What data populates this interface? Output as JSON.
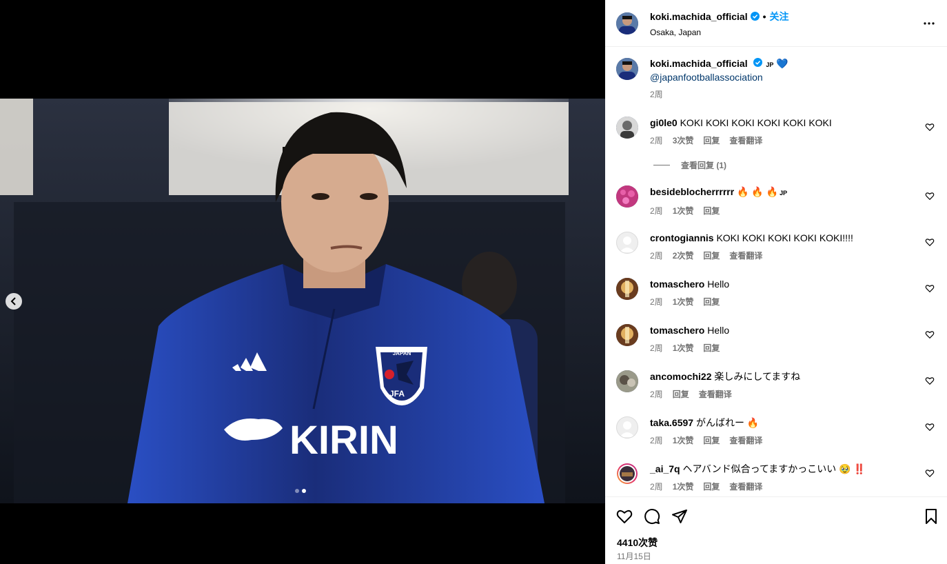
{
  "header": {
    "username": "koki.machida_official",
    "separator": "•",
    "follow_label": "关注",
    "location": "Osaka, Japan"
  },
  "caption": {
    "username": "koki.machida_official",
    "flag_text": "JP",
    "mention": "@japanfootballassociation",
    "time": "2周"
  },
  "comments": [
    {
      "username": "gi0le0",
      "text": "KOKI KOKI KOKI KOKI KOKI KOKI",
      "time": "2周",
      "likes": "3次赞",
      "reply": "回复",
      "translate": "查看翻译"
    },
    {
      "username": "besideblocherrrrrr",
      "text": "🔥 🔥 🔥",
      "flag": "JP",
      "time": "2周",
      "likes": "1次赞",
      "reply": "回复"
    },
    {
      "username": "crontogiannis",
      "text": "KOKI KOKI KOKI KOKI KOKI!!!!",
      "time": "2周",
      "likes": "2次赞",
      "reply": "回复",
      "translate": "查看翻译"
    },
    {
      "username": "tomaschero",
      "text": "Hello",
      "time": "2周",
      "likes": "1次赞",
      "reply": "回复"
    },
    {
      "username": "tomaschero",
      "text": "Hello",
      "time": "2周",
      "likes": "1次赞",
      "reply": "回复"
    },
    {
      "username": "ancomochi22",
      "text": "楽しみにしてますね",
      "time": "2周",
      "reply": "回复",
      "translate": "查看翻译"
    },
    {
      "username": "taka.6597",
      "text": "がんばれー 🔥",
      "time": "2周",
      "likes": "1次赞",
      "reply": "回复",
      "translate": "查看翻译"
    },
    {
      "username": "_ai_7q",
      "text": "ヘアバンド似合ってますかっこいい 🥹 ‼️",
      "time": "2周",
      "likes": "1次赞",
      "reply": "回复",
      "translate": "查看翻译"
    }
  ],
  "view_replies": "查看回复 (1)",
  "footer": {
    "likes": "4410次赞",
    "date": "11月15日"
  },
  "media": {
    "jersey_text": "KIRIN",
    "crest_top": "JAPAN",
    "crest_bottom": "JFA",
    "slide_count": 2,
    "active_slide": 2
  },
  "colors": {
    "link_blue": "#0095f6",
    "mention_blue": "#00376b",
    "secondary_text": "#737373",
    "jersey_blue": "#1e3a8f"
  },
  "icons": [
    "verified-badge-icon",
    "more-options-icon",
    "heart-icon",
    "comment-icon",
    "share-icon",
    "bookmark-icon",
    "chevron-left-icon"
  ]
}
